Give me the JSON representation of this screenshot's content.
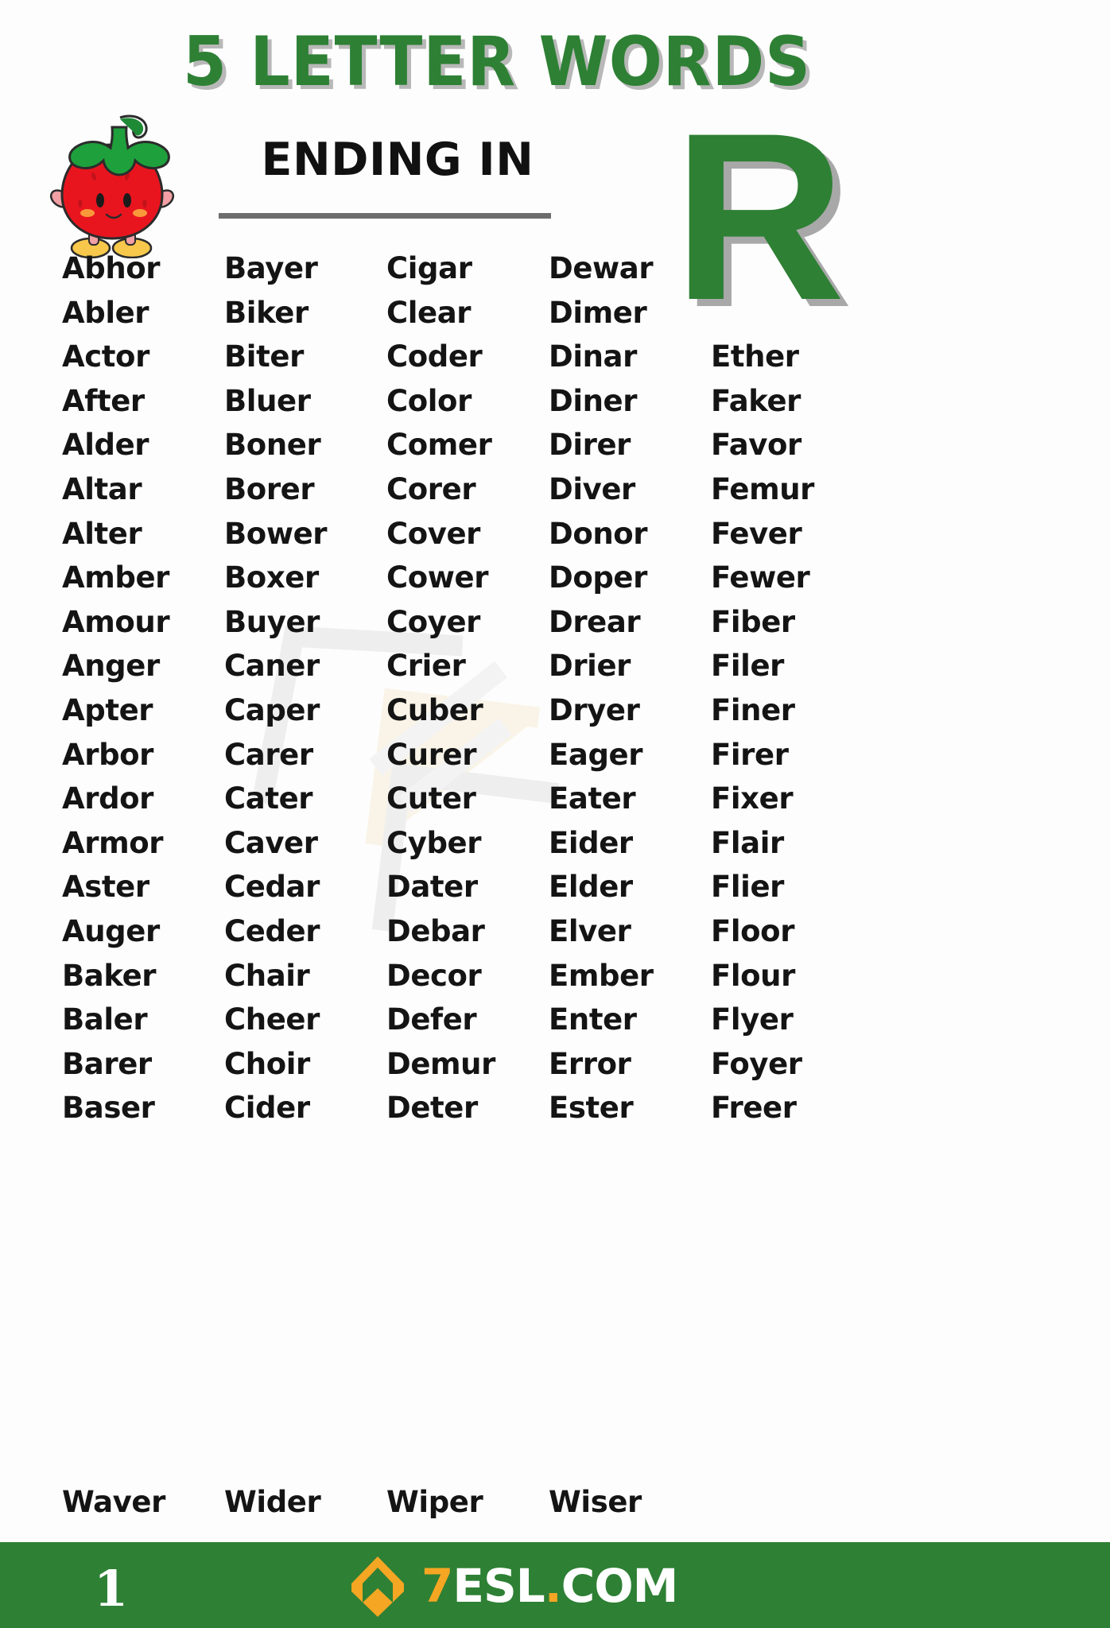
{
  "header": {
    "title": "5 LETTER WORDS",
    "subtitle": "ENDING IN",
    "letter": "R",
    "mascot_icon": "strawberry-mascot-icon",
    "title_color": "#2E8034",
    "letter_color": "#2E8034",
    "shadow_color": "#b0b0b0"
  },
  "watermark": {
    "text": "7ESL.COM"
  },
  "columns": [
    {
      "id": "column-1",
      "words": [
        "Abhor",
        "Abler",
        "Actor",
        "After",
        "Alder",
        "Altar",
        "Alter",
        "Amber",
        "Amour",
        "Anger",
        "Apter",
        "Arbor",
        "Ardor",
        "Armor",
        "Aster",
        "Auger",
        "Baker",
        "Baler",
        "Barer",
        "Baser"
      ]
    },
    {
      "id": "column-2",
      "words": [
        "Bayer",
        "Biker",
        "Biter",
        "Bluer",
        "Boner",
        "Borer",
        "Bower",
        "Boxer",
        "Buyer",
        "Caner",
        "Caper",
        "Carer",
        "Cater",
        "Caver",
        "Cedar",
        "Ceder",
        "Chair",
        "Cheer",
        "Choir",
        "Cider"
      ]
    },
    {
      "id": "column-3",
      "words": [
        "Cigar",
        "Clear",
        "Coder",
        "Color",
        "Comer",
        "Corer",
        "Cover",
        "Cower",
        "Coyer",
        "Crier",
        "Cuber",
        "Curer",
        "Cuter",
        "Cyber",
        "Dater",
        "Debar",
        "Decor",
        "Defer",
        "Demur",
        "Deter"
      ]
    },
    {
      "id": "column-4",
      "words": [
        "Dewar",
        "Dimer",
        "Dinar",
        "Diner",
        "Direr",
        "Diver",
        "Donor",
        "Doper",
        "Drear",
        "Drier",
        "Dryer",
        "Eager",
        "Eater",
        "Eider",
        "Elder",
        "Elver",
        "Ember",
        "Enter",
        "Error",
        "Ester"
      ]
    },
    {
      "id": "column-5",
      "words": [
        "",
        "",
        "Ether",
        "Faker",
        "Favor",
        "Femur",
        "Fever",
        "Fewer",
        "Fiber",
        "Filer",
        "Finer",
        "Firer",
        "Fixer",
        "Flair",
        "Flier",
        "Floor",
        "Flour",
        "Flyer",
        "Foyer",
        "Freer"
      ]
    }
  ],
  "last_row": {
    "words": [
      "Waver",
      "Wider",
      "Wiper",
      "Wiser",
      ""
    ]
  },
  "footer": {
    "page_number": "1",
    "brand_seven": "7",
    "brand_esl": "ESL",
    "brand_dot": ".",
    "brand_com": "COM",
    "logo_icon": "7esl-diamond-logo-icon",
    "background_color": "#2E8034",
    "accent_color": "#F5A623"
  }
}
